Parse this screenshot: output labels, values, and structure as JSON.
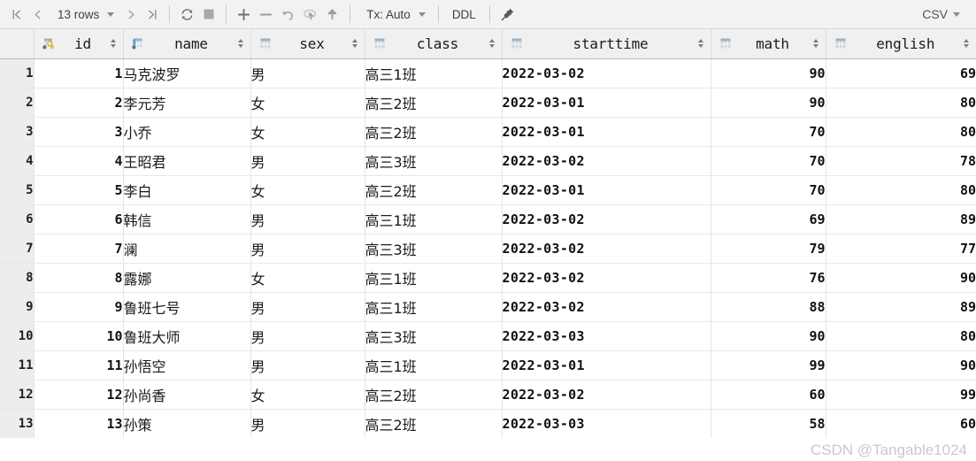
{
  "toolbar": {
    "first_page_icon": "go-to-first-page-icon",
    "prev_page_icon": "previous-page-icon",
    "rows_label": "13 rows",
    "next_page_icon": "next-page-icon",
    "last_page_icon": "go-to-last-page-icon",
    "reload_icon": "refresh-icon",
    "stop_icon": "stop-icon",
    "add_row_icon": "add-row-icon",
    "delete_row_icon": "delete-row-icon",
    "revert_icon": "revert-changes-icon",
    "submit_icon": "submit-changes-icon",
    "upload_icon": "upload-icon",
    "tx_label": "Tx: Auto",
    "ddl_label": "DDL",
    "pin_icon": "pin-icon",
    "export_label": "CSV",
    "colors": {
      "toolbar_bg": "#f2f2f2",
      "header_bg": "#f0f0f0",
      "gutter_bg": "#ededed",
      "key_gold": "#e8b43a",
      "icon_blue": "#4aa3e0",
      "icon_grey": "#9aa7b0",
      "text": "#1b1b1b"
    }
  },
  "grid": {
    "columns": [
      {
        "name": "id",
        "icon": "table-primary-key-icon",
        "sortable": true
      },
      {
        "name": "name",
        "icon": "table-indexed-column-icon",
        "sortable": true
      },
      {
        "name": "sex",
        "icon": "table-column-icon",
        "sortable": true
      },
      {
        "name": "class",
        "icon": "table-column-icon",
        "sortable": true
      },
      {
        "name": "starttime",
        "icon": "table-column-icon",
        "sortable": true
      },
      {
        "name": "math",
        "icon": "table-column-icon",
        "sortable": true
      },
      {
        "name": "english",
        "icon": "table-column-icon",
        "sortable": true
      }
    ],
    "rows": [
      {
        "n": "1",
        "id": "1",
        "name": "马克波罗",
        "sex": "男",
        "class": "高三1班",
        "starttime": "2022-03-02",
        "math": "90",
        "english": "69"
      },
      {
        "n": "2",
        "id": "2",
        "name": "李元芳",
        "sex": "女",
        "class": "高三2班",
        "starttime": "2022-03-01",
        "math": "90",
        "english": "80"
      },
      {
        "n": "3",
        "id": "3",
        "name": "小乔",
        "sex": "女",
        "class": "高三2班",
        "starttime": "2022-03-01",
        "math": "70",
        "english": "80"
      },
      {
        "n": "4",
        "id": "4",
        "name": "王昭君",
        "sex": "男",
        "class": "高三3班",
        "starttime": "2022-03-02",
        "math": "70",
        "english": "78"
      },
      {
        "n": "5",
        "id": "5",
        "name": "李白",
        "sex": "女",
        "class": "高三2班",
        "starttime": "2022-03-01",
        "math": "70",
        "english": "80"
      },
      {
        "n": "6",
        "id": "6",
        "name": "韩信",
        "sex": "男",
        "class": "高三1班",
        "starttime": "2022-03-02",
        "math": "69",
        "english": "89"
      },
      {
        "n": "7",
        "id": "7",
        "name": "澜",
        "sex": "男",
        "class": "高三3班",
        "starttime": "2022-03-02",
        "math": "79",
        "english": "77"
      },
      {
        "n": "8",
        "id": "8",
        "name": "露娜",
        "sex": "女",
        "class": "高三1班",
        "starttime": "2022-03-02",
        "math": "76",
        "english": "90"
      },
      {
        "n": "9",
        "id": "9",
        "name": "鲁班七号",
        "sex": "男",
        "class": "高三1班",
        "starttime": "2022-03-02",
        "math": "88",
        "english": "89"
      },
      {
        "n": "10",
        "id": "10",
        "name": "鲁班大师",
        "sex": "男",
        "class": "高三3班",
        "starttime": "2022-03-03",
        "math": "90",
        "english": "80"
      },
      {
        "n": "11",
        "id": "11",
        "name": "孙悟空",
        "sex": "男",
        "class": "高三1班",
        "starttime": "2022-03-01",
        "math": "99",
        "english": "90"
      },
      {
        "n": "12",
        "id": "12",
        "name": "孙尚香",
        "sex": "女",
        "class": "高三2班",
        "starttime": "2022-03-02",
        "math": "60",
        "english": "99"
      },
      {
        "n": "13",
        "id": "13",
        "name": "孙策",
        "sex": "男",
        "class": "高三2班",
        "starttime": "2022-03-03",
        "math": "58",
        "english": "60"
      }
    ]
  },
  "watermark": {
    "text": "CSDN @Tangable1024"
  }
}
